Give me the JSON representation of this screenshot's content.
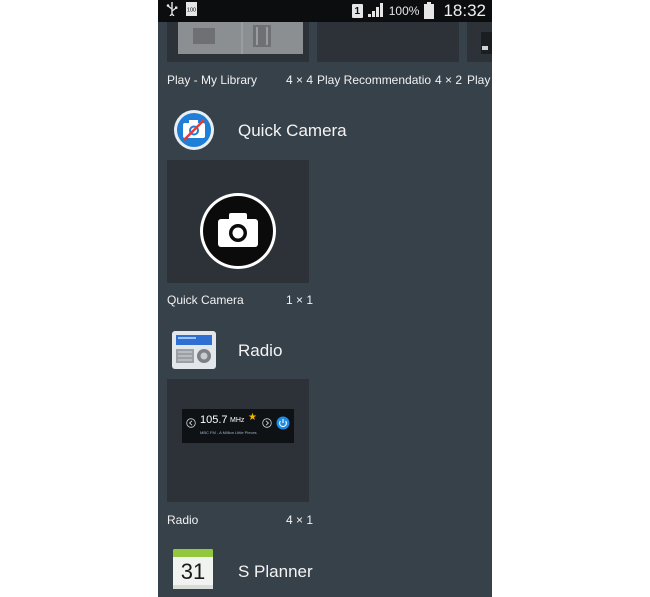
{
  "status_bar": {
    "sim_slot": "1",
    "battery_percent": "100%",
    "time": "18:32",
    "left_icons": [
      "usb-icon",
      "download-notification-icon"
    ]
  },
  "play_row": {
    "items": [
      {
        "label": "Play - My Library",
        "size": "4 × 4"
      },
      {
        "label": "Play Recommendatio..",
        "size": "4 × 2"
      },
      {
        "label": "Play",
        "size": ""
      }
    ]
  },
  "sections": [
    {
      "title": "Quick Camera",
      "icon": "quick-camera-icon",
      "widgets": [
        {
          "label": "Quick Camera",
          "size": "1 × 1"
        }
      ]
    },
    {
      "title": "Radio",
      "icon": "radio-icon",
      "widgets": [
        {
          "label": "Radio",
          "size": "4 × 1",
          "preview": {
            "frequency": "105.7",
            "unit": "MHz",
            "station": "MBC FM - A Million Little Pieces"
          }
        }
      ]
    },
    {
      "title": "S Planner",
      "icon": "s-planner-icon",
      "icon_day": "31",
      "widgets": []
    }
  ],
  "colors": {
    "background": "#37414a",
    "tile": "#2c3238",
    "status_bar": "#0b0d0f",
    "text": "#f2f2f2"
  }
}
